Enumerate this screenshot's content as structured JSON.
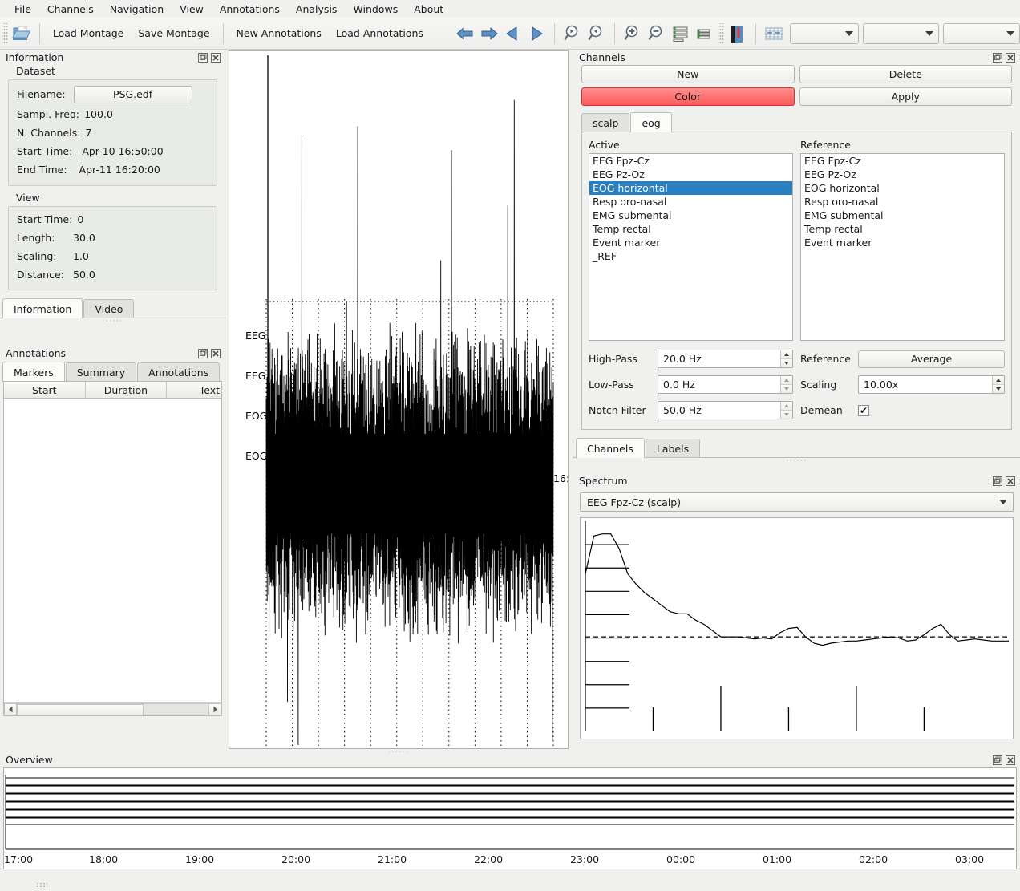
{
  "menubar": {
    "items": [
      {
        "label": "File"
      },
      {
        "label": "Channels"
      },
      {
        "label": "Navigation"
      },
      {
        "label": "View"
      },
      {
        "label": "Annotations"
      },
      {
        "label": "Analysis"
      },
      {
        "label": "Windows"
      },
      {
        "label": "About"
      }
    ]
  },
  "toolbar": {
    "open_icon": "open-folder-icon",
    "buttons": [
      {
        "label": "Load Montage",
        "name": "load-montage-button"
      },
      {
        "label": "Save Montage",
        "name": "save-montage-button"
      },
      {
        "label": "New Annotations",
        "name": "new-annotations-button"
      },
      {
        "label": "Load Annotations",
        "name": "load-annotations-button"
      }
    ],
    "nav_icons": [
      {
        "name": "step-back-icon"
      },
      {
        "name": "step-forward-icon"
      },
      {
        "name": "page-back-icon"
      },
      {
        "name": "page-forward-icon"
      }
    ],
    "zoom_icons": [
      {
        "name": "narrow-window-icon"
      },
      {
        "name": "widen-window-icon"
      },
      {
        "name": "zoom-in-icon"
      },
      {
        "name": "zoom-out-icon"
      }
    ],
    "list_icons": [
      {
        "name": "less-distance-icon"
      },
      {
        "name": "more-distance-icon"
      }
    ],
    "extra_icons": [
      {
        "name": "color-scheme-icon"
      },
      {
        "name": "grid-icon"
      }
    ],
    "combos": [
      {
        "name": "combo-1",
        "value": ""
      },
      {
        "name": "combo-2",
        "value": ""
      },
      {
        "name": "combo-3",
        "value": ""
      }
    ]
  },
  "information": {
    "title": "Information",
    "dataset_label": "Dataset",
    "dataset": [
      {
        "key": "Filename:",
        "value": "PSG.edf",
        "is_button": true
      },
      {
        "key": "Sampl. Freq:",
        "value": "100.0"
      },
      {
        "key": "N. Channels:",
        "value": "7"
      },
      {
        "key": "Start Time:",
        "value": "Apr-10 16:50:00"
      },
      {
        "key": "End Time:",
        "value": "Apr-11 16:20:00"
      }
    ],
    "view_label": "View",
    "view": [
      {
        "key": "Start Time:",
        "value": "0"
      },
      {
        "key": "Length:",
        "value": "30.0"
      },
      {
        "key": "Scaling:",
        "value": "1.0"
      },
      {
        "key": "Distance:",
        "value": "50.0"
      }
    ],
    "tabs": [
      {
        "label": "Information",
        "active": true
      },
      {
        "label": "Video",
        "active": false
      }
    ]
  },
  "annotations": {
    "title": "Annotations",
    "tabs": [
      {
        "label": "Markers",
        "active": true
      },
      {
        "label": "Summary",
        "active": false
      },
      {
        "label": "Annotations",
        "active": false
      }
    ],
    "columns": [
      "Start",
      "Duration",
      "Text"
    ],
    "rows": []
  },
  "trace": {
    "channel_labels": [
      "EEG",
      "EEG",
      "EOG",
      "EOG"
    ],
    "right_time_label": "16:"
  },
  "channels": {
    "title": "Channels",
    "buttons": {
      "new": "New",
      "delete": "Delete",
      "color": "Color",
      "apply": "Apply"
    },
    "color_button_color": "#fb5c5c",
    "group_tabs": [
      {
        "label": "scalp",
        "active": false
      },
      {
        "label": "eog",
        "active": true
      }
    ],
    "active_label": "Active",
    "reference_label": "Reference",
    "active_list": [
      "EEG Fpz-Cz",
      "EEG Pz-Oz",
      "EOG horizontal",
      "Resp oro-nasal",
      "EMG submental",
      "Temp rectal",
      "Event marker",
      "_REF"
    ],
    "active_selected": "EOG horizontal",
    "selection_color": "#2a7fc1",
    "reference_list": [
      "EEG Fpz-Cz",
      "EEG Pz-Oz",
      "EOG horizontal",
      "Resp oro-nasal",
      "EMG submental",
      "Temp rectal",
      "Event marker"
    ],
    "filters": [
      {
        "label": "High-Pass",
        "value": "20.0 Hz"
      },
      {
        "label": "Low-Pass",
        "value": "0.0 Hz"
      },
      {
        "label": "Notch Filter",
        "value": "50.0 Hz"
      }
    ],
    "reference_field_label": "Reference",
    "reference_value": "Average",
    "scaling_label": "Scaling",
    "scaling_value": "10.00x",
    "demean_label": "Demean",
    "demean_checked": true,
    "check_glyph": "✔",
    "bottom_tabs": [
      {
        "label": "Channels",
        "active": true
      },
      {
        "label": "Labels",
        "active": false
      }
    ]
  },
  "spectrum": {
    "title": "Spectrum",
    "selected_channel": "EEG Fpz-Cz (scalp)",
    "chart_data": {
      "type": "line",
      "title": "",
      "xlabel": "",
      "ylabel": "",
      "grid": false,
      "legend": "none",
      "xlim": [
        0,
        50
      ],
      "ylim": [
        0,
        10
      ],
      "x": [
        0,
        1,
        2,
        3,
        4,
        5,
        6,
        7,
        8,
        9,
        10,
        11,
        12,
        13,
        14,
        15,
        16,
        17,
        18,
        19,
        20,
        21,
        22,
        23,
        24,
        25,
        26,
        27,
        28,
        29,
        30,
        31,
        32,
        33,
        34,
        35,
        36,
        37,
        38,
        39,
        40,
        41,
        42,
        43,
        44,
        45,
        46,
        47,
        48,
        49,
        50
      ],
      "values": [
        7.5,
        9.3,
        9.4,
        9.4,
        8.7,
        7.5,
        7.0,
        6.6,
        6.3,
        6.0,
        5.7,
        5.6,
        5.6,
        5.3,
        5.1,
        4.8,
        4.5,
        4.5,
        4.5,
        4.45,
        4.4,
        4.45,
        4.4,
        4.7,
        4.9,
        4.95,
        4.5,
        4.2,
        4.1,
        4.2,
        4.25,
        4.3,
        4.3,
        4.35,
        4.4,
        4.45,
        4.5,
        4.45,
        4.3,
        4.35,
        4.6,
        4.9,
        5.1,
        4.6,
        4.3,
        4.35,
        4.4,
        4.35,
        4.3,
        4.3,
        4.3
      ],
      "reference_line": 4.5,
      "reference_line_style": "dashed",
      "y_tick_marks": 8,
      "x_tick_marks": [
        8,
        16,
        24,
        32,
        40
      ]
    }
  },
  "overview": {
    "title": "Overview",
    "time_labels": [
      "17:00",
      "18:00",
      "19:00",
      "20:00",
      "21:00",
      "22:00",
      "23:00",
      "00:00",
      "01:00",
      "02:00",
      "03:00"
    ],
    "track_count": 7
  },
  "icons": {
    "float_glyph": "⧉",
    "close_glyph": "✕",
    "arrow_left": "◀",
    "arrow_right": "▶"
  }
}
